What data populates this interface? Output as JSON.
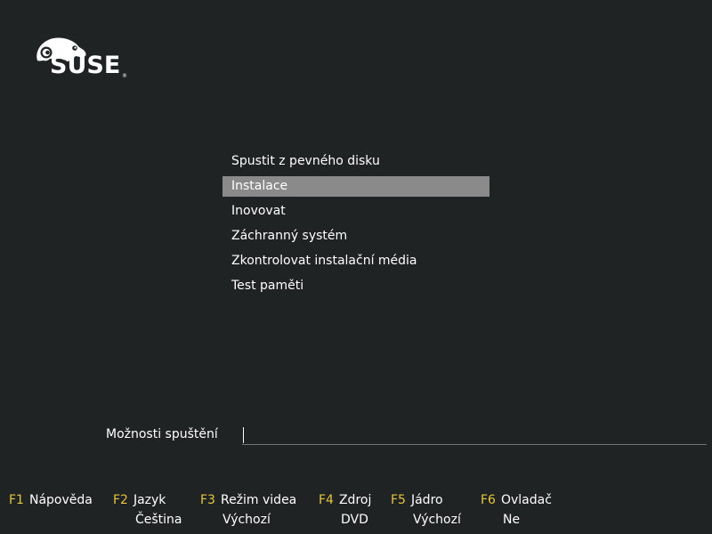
{
  "brand": {
    "logo_text": "SUSE",
    "registered": "®"
  },
  "boot_menu": {
    "selected_index": 1,
    "items": [
      {
        "label": "Spustit z pevného disku"
      },
      {
        "label": "Instalace"
      },
      {
        "label": "Inovovat"
      },
      {
        "label": "Záchranný systém"
      },
      {
        "label": "Zkontrolovat instalační média"
      },
      {
        "label": "Test paměti"
      }
    ]
  },
  "boot_options": {
    "label": "Možnosti spuštění",
    "value": ""
  },
  "function_keys": [
    {
      "key": "F1",
      "label": "Nápověda",
      "value": ""
    },
    {
      "key": "F2",
      "label": "Jazyk",
      "value": "Čeština"
    },
    {
      "key": "F3",
      "label": "Režim videa",
      "value": "Výchozí"
    },
    {
      "key": "F4",
      "label": "Zdroj",
      "value": "DVD"
    },
    {
      "key": "F5",
      "label": "Jádro",
      "value": "Výchozí"
    },
    {
      "key": "F6",
      "label": "Ovladač",
      "value": "Ne"
    }
  ],
  "colors": {
    "background": "#1f2323",
    "selection": "#8a8a8a",
    "fkey_accent": "#e5c53c",
    "text": "#ffffff"
  }
}
